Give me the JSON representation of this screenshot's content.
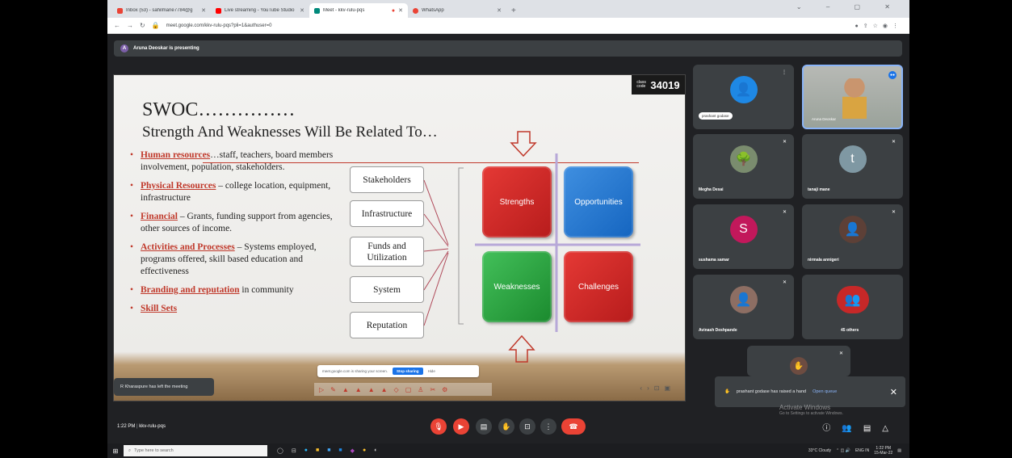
{
  "browser": {
    "tabs": [
      {
        "label": "Inbox (53) - sahilmane7784@g",
        "favicon_color": "#ea4335"
      },
      {
        "label": "Live streaming - YouTube Studio",
        "favicon_color": "#ff0000"
      },
      {
        "label": "Meet - kkv-rulu-pqs",
        "favicon_color": "#00897b"
      },
      {
        "label": "WhatsApp",
        "favicon_color": "#ea4335"
      }
    ],
    "new_tab": "+",
    "url": "meet.google.com/kkv-rulu-pqs?pli=1&authuser=0"
  },
  "presenting_banner": {
    "avatar_letter": "A",
    "text": "Aruna Deoskar is presenting"
  },
  "slide": {
    "class_code_label": "class code",
    "class_code": "34019",
    "title_line1": "SWOC……………",
    "title_line2": "Strength And Weaknesses Will Be Related To…",
    "bullets": [
      {
        "key": "Human resources",
        "rest": "…staff, teachers, board members involvement, population, stakeholders."
      },
      {
        "key": "Physical Resources",
        "rest": " – college location, equipment, infrastructure"
      },
      {
        "key": "Financial",
        "rest": " – Grants, funding support from agencies, other sources of income."
      },
      {
        "key": "Activities and Processes",
        "rest": " – Systems employed, programs offered, skill based education and effectiveness"
      },
      {
        "key": "Branding and reputation",
        "rest": " in community"
      },
      {
        "key": "Skill Sets",
        "rest": ""
      }
    ],
    "boxes": [
      "Stakeholders",
      "Infrastructure",
      "Funds and Utilization",
      "System",
      "Reputation"
    ],
    "quadrants": [
      "Strengths",
      "Opportunities",
      "Weaknesses",
      "Challenges"
    ],
    "share_notice": "meet.google.com is sharing your screen.",
    "stop_sharing": "Stop sharing",
    "hide": "Hide"
  },
  "left_toast": "R Kharaspure has left the meeting",
  "participants": [
    {
      "name": "prashant godase",
      "avatar_color": "#1e88e5"
    },
    {
      "name": "Aruna Deoskar",
      "avatar_color": "#9e9e9e"
    },
    {
      "name": "Megha Desai",
      "avatar_color": "#7a8c6e"
    },
    {
      "name": "tanaji mane",
      "avatar_color": "#7f98a3",
      "letter": "t"
    },
    {
      "name": "sushama samar",
      "avatar_color": "#c2185b",
      "letter": "S"
    },
    {
      "name": "nirmala annigeri",
      "avatar_color": "#5d4037"
    },
    {
      "name": "Avinash Deshpande",
      "avatar_color": "#8d6e63"
    },
    {
      "name": "45 others",
      "avatar_color": "#c62828"
    }
  ],
  "raise_hand_toast": {
    "text": "prashant godase has raised a hand",
    "action": "Open queue"
  },
  "watermark": {
    "line1": "Activate Windows",
    "line2": "Go to Settings to activate Windows."
  },
  "meeting": {
    "time": "1:22 PM",
    "code": "kkv-rulu-pqs"
  },
  "taskbar": {
    "search_placeholder": "Type here to search",
    "weather": "33°C  Cloudy",
    "lang": "ENG IN",
    "time": "1:22 PM",
    "date": "15-Mar-22"
  },
  "colors": {
    "accent": "#1a73e8",
    "danger": "#ea4335",
    "slide_red": "#c0392b"
  }
}
